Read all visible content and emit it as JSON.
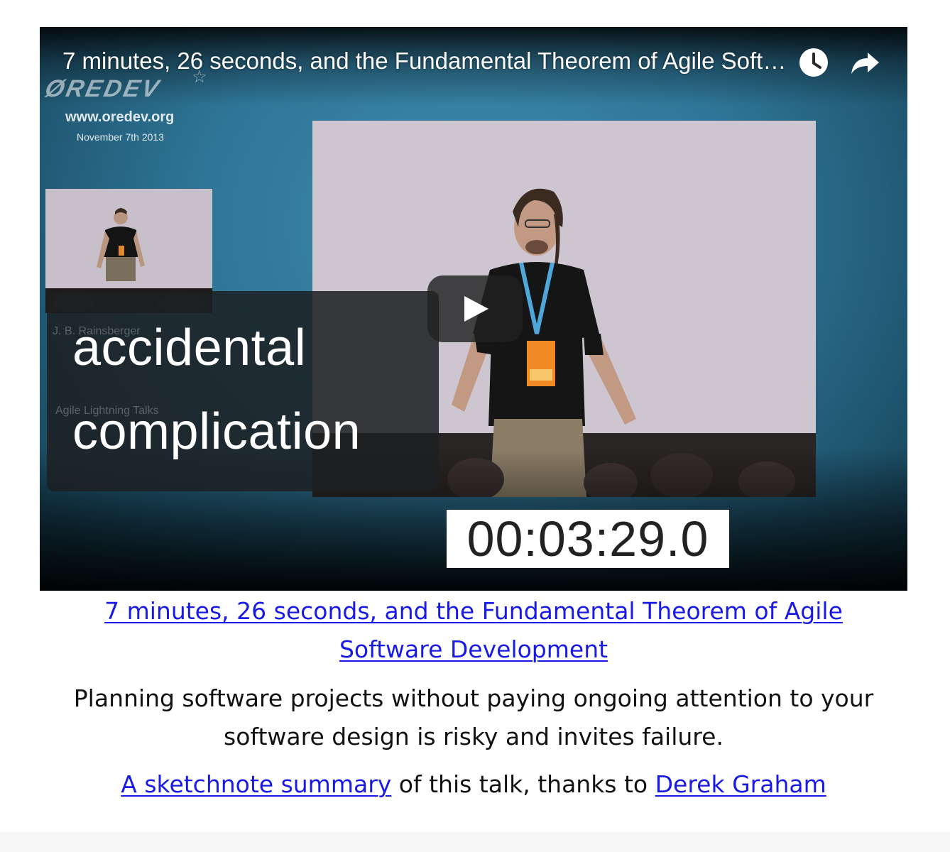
{
  "video": {
    "title": "7 minutes, 26 seconds, and the Fundamental Theorem of Agile Software Development",
    "logo_text": "ØREDEV",
    "logo_url": "www.oredev.org",
    "logo_date": "November 7th 2013",
    "caption_ghost_1": "J. B. Rainsberger",
    "caption_ghost_2": "Agile Lightning Talks",
    "caption_line_1": "accidental",
    "caption_line_2": "complication",
    "timer": "00:03:29.0",
    "icons": {
      "watch_later": "clock-icon",
      "share": "share-arrow-icon",
      "play": "play-icon"
    }
  },
  "article": {
    "title_link": "7 minutes, 26 seconds, and the Fundamental Theorem of Agile Software Development",
    "description": "Planning software projects without paying ongoing attention to your software design is risky and invites failure.",
    "sketchnote_link": "A sketchnote summary",
    "sketchnote_middle": " of this talk, thanks to ",
    "author_link": "Derek Graham"
  },
  "colors": {
    "link": "#1a1ae6",
    "text": "#111111",
    "play_button_bg": "#212121"
  }
}
